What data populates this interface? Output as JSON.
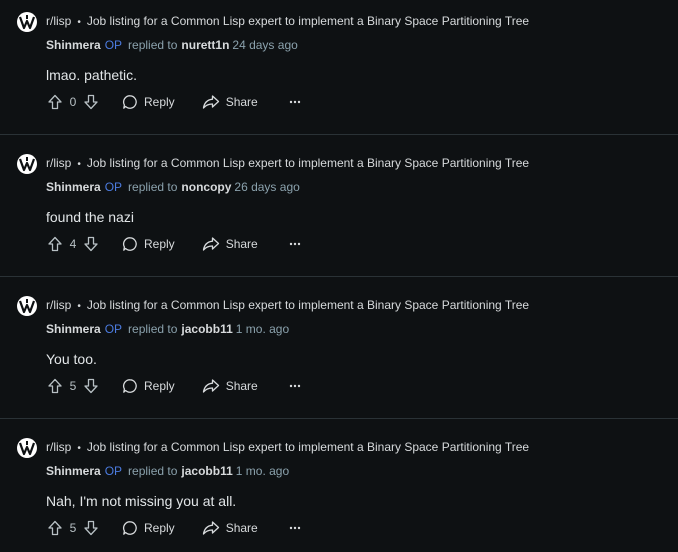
{
  "comments": [
    {
      "subreddit": "r/lisp",
      "separator": "•",
      "post_title": "Job listing for a Common Lisp expert to implement a Binary Space Partitioning Tree",
      "author": "Shinmera",
      "op_badge": "OP",
      "replied_to_label": "replied to",
      "reply_target": "nurett1n",
      "time": "24 days ago",
      "body": "lmao. pathetic.",
      "score": "0",
      "reply_label": "Reply",
      "share_label": "Share"
    },
    {
      "subreddit": "r/lisp",
      "separator": "•",
      "post_title": "Job listing for a Common Lisp expert to implement a Binary Space Partitioning Tree",
      "author": "Shinmera",
      "op_badge": "OP",
      "replied_to_label": "replied to",
      "reply_target": "noncopy",
      "time": "26 days ago",
      "body": "found the nazi",
      "score": "4",
      "reply_label": "Reply",
      "share_label": "Share"
    },
    {
      "subreddit": "r/lisp",
      "separator": "•",
      "post_title": "Job listing for a Common Lisp expert to implement a Binary Space Partitioning Tree",
      "author": "Shinmera",
      "op_badge": "OP",
      "replied_to_label": "replied to",
      "reply_target": "jacobb11",
      "time": "1 mo. ago",
      "body": "You too.",
      "score": "5",
      "reply_label": "Reply",
      "share_label": "Share"
    },
    {
      "subreddit": "r/lisp",
      "separator": "•",
      "post_title": "Job listing for a Common Lisp expert to implement a Binary Space Partitioning Tree",
      "author": "Shinmera",
      "op_badge": "OP",
      "replied_to_label": "replied to",
      "reply_target": "jacobb11",
      "time": "1 mo. ago",
      "body": "Nah, I'm not missing you at all.",
      "score": "5",
      "reply_label": "Reply",
      "share_label": "Share"
    }
  ],
  "icons": {
    "subreddit_avatar": "lisp-lambda-icon",
    "upvote": "upvote-arrow-icon",
    "downvote": "downvote-arrow-icon",
    "reply": "speech-bubble-icon",
    "share": "share-arrow-icon",
    "more": "ellipsis-icon"
  },
  "colors": {
    "background": "#0e1113",
    "op_badge": "#4c7ce0",
    "muted_text": "#8ba2ad",
    "divider": "#2a3236"
  }
}
